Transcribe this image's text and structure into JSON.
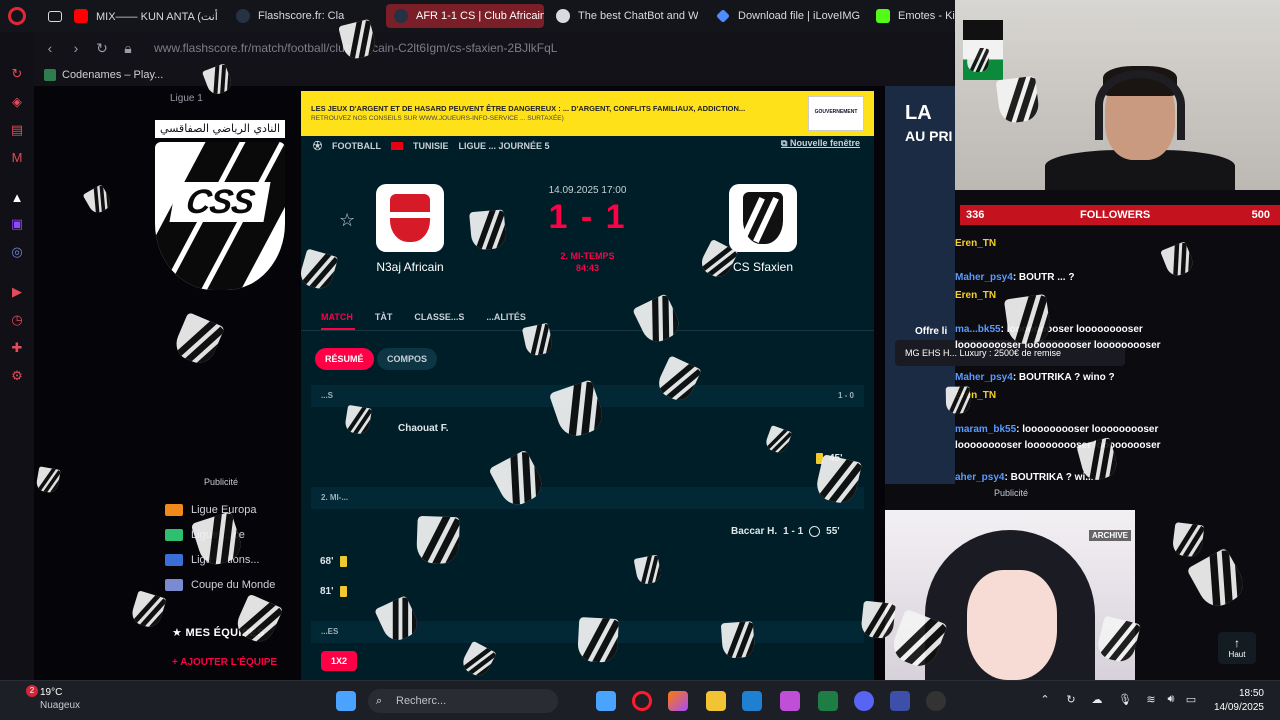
{
  "tabs": [
    {
      "label": "",
      "icon": "email-icon"
    },
    {
      "label": "MIX—— KUN ANTA (أنت",
      "icon": "youtube-icon",
      "color": "#ff0000"
    },
    {
      "label": "Flashscore.fr: Cla",
      "icon": "flashscore-icon"
    },
    {
      "label": "AFR 1-1 CS | Club Africain",
      "icon": "flashscore-icon",
      "active": true
    },
    {
      "label": "The best ChatBot and Wi",
      "icon": "chatbot-icon"
    },
    {
      "label": "Download file | iLoveIMG",
      "icon": "iloveimg-icon"
    },
    {
      "label": "Emotes - Kic",
      "icon": "kick-icon",
      "color": "#53fc18"
    }
  ],
  "address": {
    "url": "www.flashscore.fr/match/football/club-africain-C2lt6Igm/cs-sfaxien-2BJlkFqL"
  },
  "bookmarks": [
    {
      "label": "Codenames – Play..."
    }
  ],
  "left": {
    "club_arabic": "النادي الرياضي الصفاقسي",
    "club_crest_text": "CSS",
    "league_crumb": "Ligue 1",
    "pub": "Publicité",
    "nav": [
      {
        "label": "Ligue Europa"
      },
      {
        "label": "Ligue ... ce"
      },
      {
        "label": "Ligu ... tions..."
      },
      {
        "label": "Coupe du Monde"
      }
    ],
    "my_teams": "MES ÉQUIPES",
    "add_team": "AJOUTER L'ÉQUIPE"
  },
  "banner": {
    "line1": "LES JEUX D'ARGENT ET DE HASARD PEUVENT ÊTRE DANGEREUX : ... D'ARGENT, CONFLITS FAMILIAUX, ADDICTION...",
    "line2": "RETROUVEZ NOS CONSEILS SUR WWW.JOUEURS-INFO-SERVICE ... SURTAXÉE)",
    "gov": "GOUVERNEMENT"
  },
  "match": {
    "breadcrumb": [
      "FOOTBALL",
      "TUNISIE",
      "LIGUE ... JOURNÉE 5"
    ],
    "new_window": "Nouvelle fenêtre",
    "datetime": "14.09.2025 17:00",
    "score": "1 - 1",
    "period": "2. MI-TEMPS",
    "clock": "84:43",
    "home": {
      "name": "N3aj Africain"
    },
    "away": {
      "name": "CS Sfaxien"
    },
    "tabs": [
      "MATCH",
      "TÀT",
      "CLASSE...S",
      "...ALITÉS"
    ],
    "subtabs": [
      "RÉSUMÉ",
      "COMPOS"
    ],
    "first_half": {
      "label": "...S",
      "score": "1 - 0"
    },
    "second_half": {
      "label": "2. MI-...",
      "score": ""
    },
    "events": [
      {
        "text": "Chaouat F.",
        "minute": ""
      },
      {
        "text": "",
        "minute": "45'"
      },
      {
        "text": "Baccar H.",
        "score": "1 - 1",
        "minute": "55'"
      },
      {
        "text": "",
        "minute": "68'"
      },
      {
        "text": "",
        "minute": "81'"
      }
    ],
    "odds_row": "...ES",
    "odds_pill": "1X2"
  },
  "right": {
    "ad_la": "LA",
    "ad_au": "AU PRI",
    "ad_offer": "Offre li",
    "promo": "MG EHS H... Luxury : 2500€ de remise",
    "pub": "Publicité",
    "archive": "ARCHIVE",
    "haut": "Haut"
  },
  "stream": {
    "followers_count": "336",
    "followers_label": "FOLLOWERS",
    "followers_goal": "500",
    "chat": [
      {
        "user": "Eren_TN",
        "text": ""
      },
      {
        "user": "Maher_psy4",
        "text": ": BOUTR ... ?"
      },
      {
        "user": "Eren_TN",
        "text": ""
      },
      {
        "user": "ma...bk55",
        "text": ": looooooooser  looooooooser"
      },
      {
        "user": "",
        "text": "looooooooser  looooooooser  looooooooser"
      },
      {
        "user": "Maher_psy4",
        "text": ": BOUTRIKA ? wino ?"
      },
      {
        "user": "Eren_TN",
        "text": ""
      },
      {
        "user": "maram_bk55",
        "text": ": looooooooser  looooooooser"
      },
      {
        "user": "",
        "text": "looooooooser  looooooooser  looooooooser"
      },
      {
        "user": "aher_psy4",
        "text": ": BOUTRIKA ? wi..."
      }
    ]
  },
  "taskbar": {
    "temp": "19°C",
    "weather": "Nuageux",
    "badge": "2",
    "search": "Recherc...",
    "time": "18:50",
    "date": "14/09/2025"
  }
}
